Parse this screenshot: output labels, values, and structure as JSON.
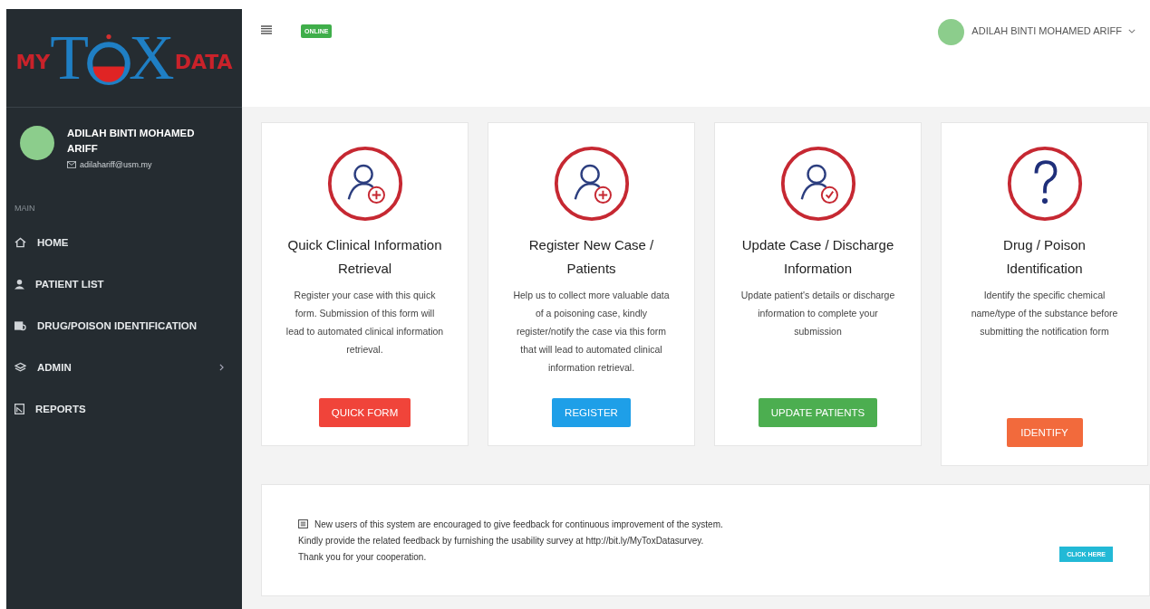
{
  "logo": {
    "prefix": "MY",
    "first_letter": "T",
    "last_letter": "X",
    "suffix": "DATA"
  },
  "sidebar": {
    "user": {
      "name": "ADILAH BINTI MOHAMED ARIFF",
      "email": "adilahariff@usm.my"
    },
    "section": "MAIN",
    "items": [
      {
        "label": "HOME",
        "kind": "home",
        "submenu": false
      },
      {
        "label": "PATIENT LIST",
        "kind": "person",
        "submenu": false
      },
      {
        "label": "DRUG/POISON IDENTIFICATION",
        "kind": "search",
        "submenu": false
      },
      {
        "label": "ADMIN",
        "kind": "layers",
        "submenu": true
      },
      {
        "label": "REPORTS",
        "kind": "report",
        "submenu": false
      }
    ]
  },
  "topbar": {
    "status": "ONLINE",
    "user_name": "ADILAH BINTI MOHAMED ARIFF"
  },
  "cards": [
    {
      "kind": "add",
      "title": "Quick Clinical Information Retrieval",
      "text": "Register your case with this quick form. Submission of this form will lead to automated clinical information retrieval.",
      "button": "QUICK FORM",
      "color": "#f0443a"
    },
    {
      "kind": "add",
      "title": "Register New Case / Patients",
      "text": "Help us to collect more valuable data of a poisoning case, kindly register/notify the case via this form that will lead to automated clinical information retrieval.",
      "button": "REGISTER",
      "color": "#1e9fe8"
    },
    {
      "kind": "check",
      "title": "Update Case / Discharge Information",
      "text": "Update patient's details or discharge information to complete your submission",
      "button": "UPDATE PATIENTS",
      "color": "#4cae50"
    },
    {
      "kind": "question",
      "title": "Drug / Poison Identification",
      "text": "Identify the specific chemical name/type of the substance before submitting the notification form",
      "button": "IDENTIFY",
      "color": "#f26a3c"
    }
  ],
  "feedback": {
    "lines": [
      "New users of this system are encouraged to give feedback for continuous improvement of the system.",
      "Kindly provide the related feedback by furnishing the usability survey at http://bit.ly/MyToxDatasurvey.",
      "Thank you for your cooperation."
    ],
    "button": "CLICK HERE"
  }
}
